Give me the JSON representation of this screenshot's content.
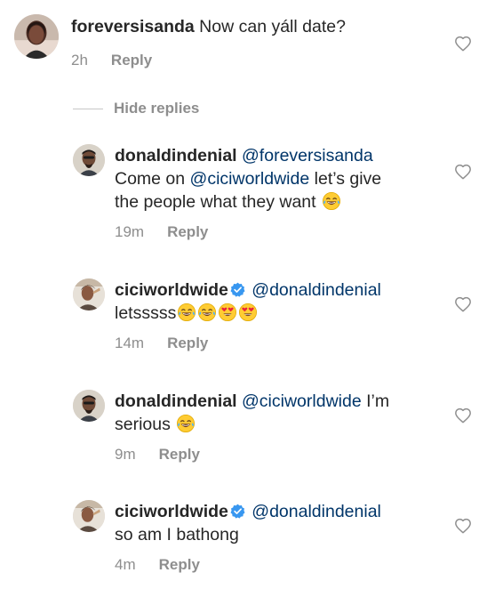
{
  "comments": [
    {
      "username": "foreversisanda",
      "mention": "",
      "text": "Now can yáll date?",
      "time": "2h",
      "reply_label": "Reply",
      "verified": false
    },
    {
      "username": "donaldindenial",
      "mention": "@foreversisanda",
      "text_part1": "Come on ",
      "mention2": "@ciciworldwide",
      "text_part2": " let’s give",
      "text_line3": "the people what they want ",
      "time": "19m",
      "reply_label": "Reply",
      "verified": false
    },
    {
      "username": "ciciworldwide",
      "mention": "@donaldindenial",
      "text": "letsssss",
      "time": "14m",
      "reply_label": "Reply",
      "verified": true
    },
    {
      "username": "donaldindenial",
      "mention": "@ciciworldwide",
      "text_part1": " I’m",
      "text_line2": "serious ",
      "time": "9m",
      "reply_label": "Reply",
      "verified": false
    },
    {
      "username": "ciciworldwide",
      "mention": "@donaldindenial",
      "text": "so am I bathong",
      "time": "4m",
      "reply_label": "Reply",
      "verified": true
    }
  ],
  "hide_replies_label": "Hide replies",
  "icons": {
    "like": "heart-outline-icon",
    "verified": "verified-badge-icon",
    "laughing": "tears-of-joy-emoji",
    "heart_eyes": "heart-eyes-emoji"
  },
  "colors": {
    "text": "#262626",
    "meta": "#8e8e8e",
    "mention": "#003569",
    "verified": "#3897f0"
  }
}
